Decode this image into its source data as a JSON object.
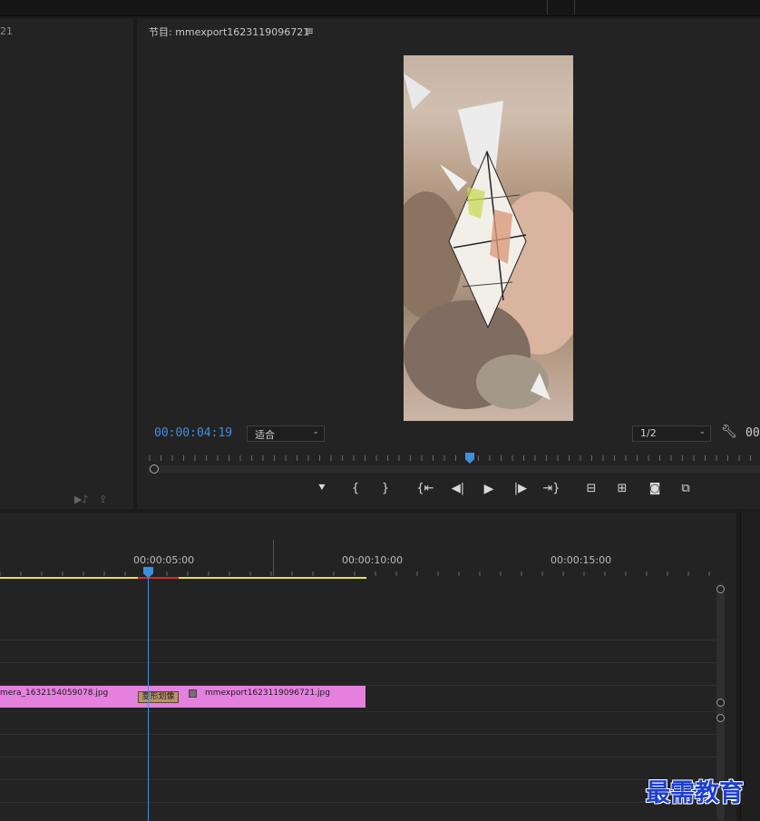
{
  "project_panel": {
    "partial_number": "21"
  },
  "program_monitor": {
    "title": "节目: mmexport1623119096721",
    "menu_icon": "≡",
    "current_timecode": "00:00:04:19",
    "fit_dropdown": "适合",
    "resolution_dropdown": "1/2",
    "right_timecode": "00",
    "transport_icons": [
      "marker-icon",
      "mark-in-icon",
      "mark-out-icon",
      "go-to-in-icon",
      "step-back-icon",
      "play-icon",
      "step-forward-icon",
      "go-to-out-icon",
      "lift-icon",
      "extract-icon",
      "export-frame-icon",
      "compare-icon"
    ]
  },
  "timeline": {
    "ruler_labels": [
      "00:00:05:00",
      "00:00:10:00",
      "00:00:15:00"
    ],
    "clip_left_name": "mera_1632154059078.jpg",
    "transition_label": "菱形划像",
    "clip_right_name": "mmexport1623119096721.jpg"
  },
  "watermark": "最需教育",
  "colors": {
    "accent_blue": "#3d8fe0",
    "clip_pink": "#e580df",
    "work_area_yellow": "#e8e24a",
    "render_red": "#d22b2b"
  }
}
